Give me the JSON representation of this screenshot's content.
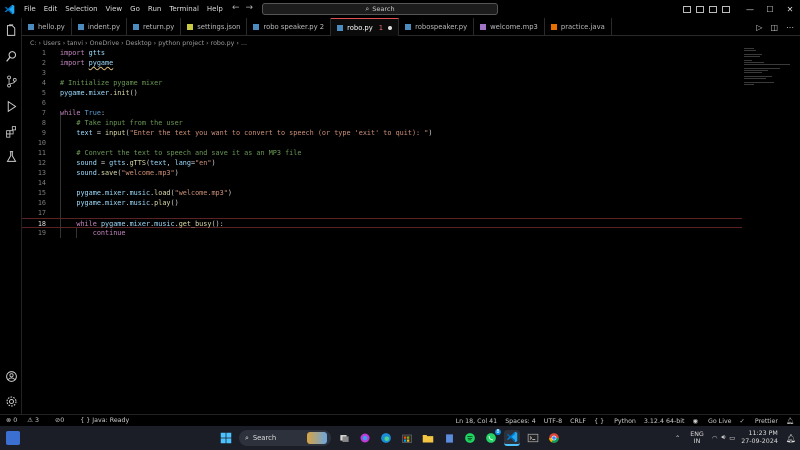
{
  "menu": [
    "File",
    "Edit",
    "Selection",
    "View",
    "Go",
    "Run",
    "Terminal",
    "Help"
  ],
  "search": {
    "label": "Search"
  },
  "tabs": [
    {
      "label": "hello.py",
      "color": "#4b8bbe"
    },
    {
      "label": "indent.py",
      "color": "#4b8bbe"
    },
    {
      "label": "return.py",
      "color": "#4b8bbe"
    },
    {
      "label": "settings.json",
      "color": "#cbcb41"
    },
    {
      "label": "robo speaker.py 2",
      "color": "#4b8bbe"
    },
    {
      "label": "robo.py",
      "color": "#4b8bbe",
      "active": true,
      "errors": "1"
    },
    {
      "label": "robospeaker.py",
      "color": "#4b8bbe"
    },
    {
      "label": "welcome.mp3",
      "color": "#a074c4"
    },
    {
      "label": "practice.java",
      "color": "#e76f00"
    }
  ],
  "breadcrumb": [
    "C:",
    "Users",
    "tanvi",
    "OneDrive",
    "Desktop",
    "python project",
    "robo.py",
    "..."
  ],
  "code_lines": [
    {
      "n": "1",
      "html": "<span class='kw'>import</span> <span class='id'>gtts</span>"
    },
    {
      "n": "2",
      "html": "<span class='kw'>import</span> <span class='id squig'>pygame</span>"
    },
    {
      "n": "3",
      "html": ""
    },
    {
      "n": "4",
      "html": "<span class='cm'># Initialize pygame mixer</span>"
    },
    {
      "n": "5",
      "html": "<span class='id'>pygame</span><span class='pl'>.</span><span class='id'>mixer</span><span class='pl'>.</span><span class='fn'>init</span><span class='pl'>()</span>"
    },
    {
      "n": "6",
      "html": ""
    },
    {
      "n": "7",
      "html": "<span class='kw'>while</span> <span class='kw2'>True</span><span class='pl'>:</span>"
    },
    {
      "n": "8",
      "html": "    <span class='cm'># Take input from the user</span>"
    },
    {
      "n": "9",
      "html": "    <span class='id'>text</span> <span class='pl'>=</span> <span class='fn'>input</span><span class='pl'>(</span><span class='str'>\"Enter the text you want to convert to speech (or type 'exit' to quit): \"</span><span class='pl'>)</span>"
    },
    {
      "n": "10",
      "html": ""
    },
    {
      "n": "11",
      "html": "    <span class='cm'># Convert the text to speech and save it as an MP3 file</span>"
    },
    {
      "n": "12",
      "html": "    <span class='id'>sound</span> <span class='pl'>=</span> <span class='id'>gtts</span><span class='pl'>.</span><span class='fn'>gTTS</span><span class='pl'>(</span><span class='id'>text</span><span class='pl'>, </span><span class='id'>lang</span><span class='pl'>=</span><span class='str'>\"en\"</span><span class='pl'>)</span>"
    },
    {
      "n": "13",
      "html": "    <span class='id'>sound</span><span class='pl'>.</span><span class='fn'>save</span><span class='pl'>(</span><span class='str'>\"welcome.mp3\"</span><span class='pl'>)</span>"
    },
    {
      "n": "14",
      "html": ""
    },
    {
      "n": "15",
      "html": "    <span class='id'>pygame</span><span class='pl'>.</span><span class='id'>mixer</span><span class='pl'>.</span><span class='id'>music</span><span class='pl'>.</span><span class='fn'>load</span><span class='pl'>(</span><span class='str'>\"welcome.mp3\"</span><span class='pl'>)</span>"
    },
    {
      "n": "16",
      "html": "    <span class='id'>pygame</span><span class='pl'>.</span><span class='id'>mixer</span><span class='pl'>.</span><span class='id'>music</span><span class='pl'>.</span><span class='fn'>play</span><span class='pl'>()</span>"
    },
    {
      "n": "17",
      "html": ""
    },
    {
      "n": "18",
      "html": "    <span class='kw'>while</span> <span class='id'>pygame</span><span class='pl'>.</span><span class='id'>mixer</span><span class='pl'>.</span><span class='id'>music</span><span class='pl'>.</span><span class='fn'>get_busy</span><span class='pl'>():</span>"
    },
    {
      "n": "19",
      "html": "        <span class='kw'>continue</span>"
    }
  ],
  "status": {
    "errors": "0",
    "warnings": "3",
    "ports": "0",
    "java": "Java: Ready",
    "position": "Ln 18, Col 41",
    "spaces": "Spaces: 4",
    "encoding": "UTF-8",
    "eol": "CRLF",
    "language": "Python",
    "interpreter": "3.12.4 64-bit",
    "golive": "Go Live",
    "prettier": "Prettier"
  },
  "taskbar": {
    "search": "Search",
    "lang_top": "ENG",
    "lang_bottom": "IN",
    "time": "11:23 PM",
    "date": "27-09-2024",
    "whatsapp_badge": "8"
  },
  "accent": "#0078d4"
}
